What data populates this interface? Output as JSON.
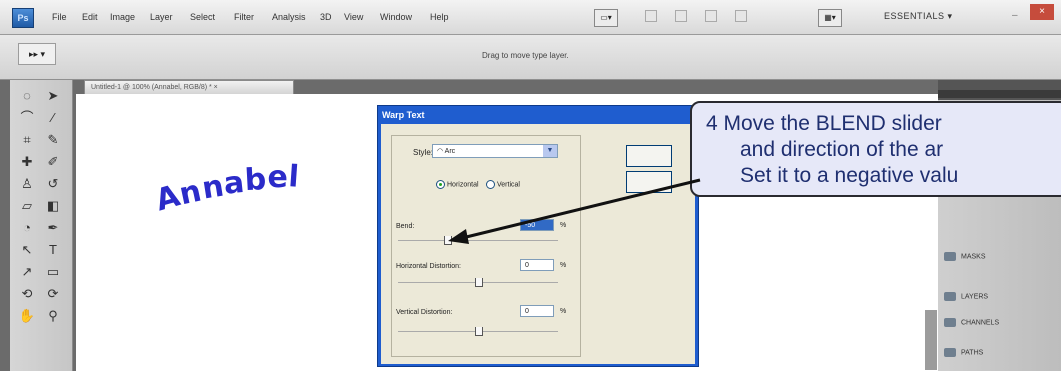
{
  "menubar": {
    "logo": "Ps",
    "items": [
      "File",
      "Edit",
      "Image",
      "Layer",
      "Select",
      "Filter",
      "Analysis",
      "3D",
      "View",
      "Window",
      "Help"
    ],
    "workspace": "ESSENTIALS"
  },
  "options_bar": {
    "tool_preset": "▸▸ ▾",
    "hint": "Drag to move type layer."
  },
  "document": {
    "tab_title": "Untitled-1 @ 100% (Annabel, RGB/8) * ×",
    "text": [
      "A",
      "n",
      "n",
      "a",
      "b",
      "e",
      "l"
    ]
  },
  "panels": {
    "items": [
      "LAYERS",
      "CHANNELS",
      "PATHS",
      "MASKS"
    ]
  },
  "warp_dialog": {
    "title": "Warp Text",
    "style_label": "Style:",
    "style_value": "Arc",
    "horizontal_label": "Horizontal",
    "vertical_label": "Vertical",
    "bend_label": "Bend:",
    "bend_value": "-50",
    "horizontal_distortion_label": "Horizontal Distortion:",
    "horizontal_distortion_value": "0",
    "vertical_distortion_label": "Vertical Distortion:",
    "vertical_distortion_value": "0",
    "percent": "%"
  },
  "callout": {
    "line1": "4  Move the BLEND slider",
    "line2": "and direction of the ar",
    "line3": "Set it to a negative valu"
  },
  "colors": {
    "dialog_title_bar": "#1f5dcf",
    "text_layer": "#2b2bc9",
    "callout_text": "#1f2f70"
  }
}
